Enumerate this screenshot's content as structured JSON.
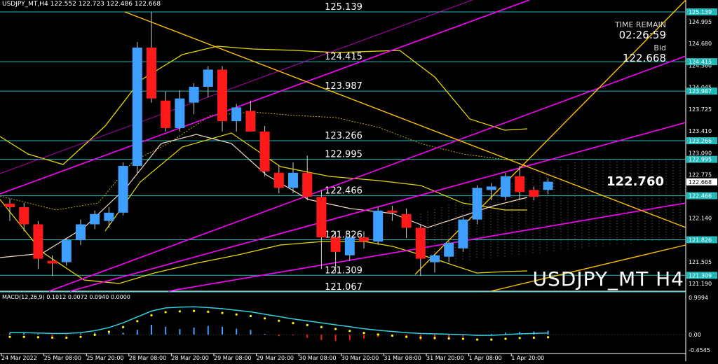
{
  "header": {
    "symbol_info": "USDJPY_MT,H4",
    "ohlc": "122.552 122.723 122.486 122.668"
  },
  "overlay": {
    "time_remain_label": "TIME REMAIN",
    "countdown": "02:26:59",
    "bid_label": "Bid",
    "bid_value": "122.668",
    "current_price_big": "122.760",
    "watermark": "USDJPY_MT H4"
  },
  "horizontal_levels": [
    {
      "label": "125.139",
      "price": 125.139
    },
    {
      "label": "124.415",
      "price": 124.415
    },
    {
      "label": "123.987",
      "price": 123.987
    },
    {
      "label": "123.266",
      "price": 123.266
    },
    {
      "label": "122.995",
      "price": 122.995
    },
    {
      "label": "122.466",
      "price": 122.466
    },
    {
      "label": "121.826",
      "price": 121.826
    },
    {
      "label": "121.309",
      "price": 121.309
    },
    {
      "label": "121.067",
      "price": 121.067
    }
  ],
  "price_axis": {
    "ticks": [
      "124.995",
      "124.680",
      "124.360",
      "124.045",
      "123.725",
      "123.410",
      "123.090",
      "122.775",
      "122.455",
      "122.140",
      "121.825",
      "121.505",
      "121.190"
    ],
    "level_tags": [
      "125.139",
      "124.415",
      "123.987",
      "123.266",
      "122.995",
      "122.668",
      "122.466",
      "121.826",
      "121.309"
    ],
    "current_tag": "122.668"
  },
  "time_axis": {
    "labels": [
      "24 Mar 2022",
      "25 Mar 08:00",
      "25 Mar 20:00",
      "28 Mar 08:00",
      "28 Mar 20:00",
      "29 Mar 08:00",
      "29 Mar 20:00",
      "30 Mar 08:00",
      "30 Mar 20:00",
      "31 Mar 08:00",
      "31 Mar 20:00",
      "1 Apr 08:00",
      "1 Apr 20:00"
    ]
  },
  "macd": {
    "header": "MACD(12,26,9) 0.1012 0.0072 0.0940 0.0000",
    "ticks": [
      "0.9994",
      "0.00",
      "-0.4545"
    ]
  },
  "colors": {
    "background": "#000000",
    "bull_candle": "#3f9fff",
    "bear_candle": "#ff1a1a",
    "level_line": "#20b8b8",
    "channel": "#ff00ff",
    "bands": "#e6d800",
    "trendline": "#ffc000",
    "macd_line": "#30d0e0",
    "macd_signal": "#ffff00"
  },
  "chart_data": {
    "type": "candlestick",
    "title": "USDJPY_MT H4",
    "categories": [
      "24 Mar 2022",
      "25 Mar 08:00",
      "25 Mar 20:00",
      "28 Mar 08:00",
      "28 Mar 20:00",
      "29 Mar 08:00",
      "29 Mar 20:00",
      "30 Mar 08:00",
      "30 Mar 20:00",
      "31 Mar 08:00",
      "31 Mar 20:00",
      "1 Apr 08:00",
      "1 Apr 20:00"
    ],
    "ohlc": [
      {
        "o": 122.35,
        "h": 122.42,
        "l": 122.1,
        "c": 122.3
      },
      {
        "o": 122.3,
        "h": 122.36,
        "l": 121.95,
        "c": 122.05
      },
      {
        "o": 122.05,
        "h": 122.1,
        "l": 121.4,
        "c": 121.55
      },
      {
        "o": 121.52,
        "h": 121.6,
        "l": 121.3,
        "c": 121.48
      },
      {
        "o": 121.5,
        "h": 121.85,
        "l": 121.45,
        "c": 121.82
      },
      {
        "o": 121.82,
        "h": 122.12,
        "l": 121.75,
        "c": 122.05
      },
      {
        "o": 122.05,
        "h": 122.25,
        "l": 121.98,
        "c": 122.2
      },
      {
        "o": 122.1,
        "h": 122.3,
        "l": 122.0,
        "c": 122.22
      },
      {
        "o": 122.22,
        "h": 122.95,
        "l": 122.18,
        "c": 122.9
      },
      {
        "o": 122.9,
        "h": 124.7,
        "l": 122.8,
        "c": 124.62
      },
      {
        "o": 124.62,
        "h": 125.14,
        "l": 123.82,
        "c": 123.88
      },
      {
        "o": 123.85,
        "h": 123.98,
        "l": 123.4,
        "c": 123.45
      },
      {
        "o": 123.45,
        "h": 124.0,
        "l": 123.4,
        "c": 123.88
      },
      {
        "o": 123.82,
        "h": 124.1,
        "l": 123.65,
        "c": 124.05
      },
      {
        "o": 124.05,
        "h": 124.35,
        "l": 123.9,
        "c": 124.3
      },
      {
        "o": 124.3,
        "h": 124.35,
        "l": 123.4,
        "c": 123.55
      },
      {
        "o": 123.55,
        "h": 123.8,
        "l": 123.4,
        "c": 123.75
      },
      {
        "o": 123.7,
        "h": 123.85,
        "l": 123.45,
        "c": 123.4
      },
      {
        "o": 123.4,
        "h": 123.48,
        "l": 122.75,
        "c": 122.82
      },
      {
        "o": 122.8,
        "h": 122.9,
        "l": 122.5,
        "c": 122.58
      },
      {
        "o": 122.58,
        "h": 122.95,
        "l": 122.5,
        "c": 122.8
      },
      {
        "o": 122.8,
        "h": 123.05,
        "l": 122.4,
        "c": 122.45
      },
      {
        "o": 122.45,
        "h": 122.55,
        "l": 121.4,
        "c": 121.86
      },
      {
        "o": 121.86,
        "h": 121.95,
        "l": 121.35,
        "c": 121.65
      },
      {
        "o": 121.6,
        "h": 121.88,
        "l": 121.52,
        "c": 121.86
      },
      {
        "o": 121.86,
        "h": 121.95,
        "l": 121.7,
        "c": 121.8
      },
      {
        "o": 121.8,
        "h": 122.3,
        "l": 121.75,
        "c": 122.25
      },
      {
        "o": 122.25,
        "h": 122.32,
        "l": 122.1,
        "c": 122.22
      },
      {
        "o": 122.2,
        "h": 122.28,
        "l": 121.85,
        "c": 122.0
      },
      {
        "o": 122.0,
        "h": 122.05,
        "l": 121.3,
        "c": 121.55
      },
      {
        "o": 121.5,
        "h": 121.62,
        "l": 121.35,
        "c": 121.6
      },
      {
        "o": 121.58,
        "h": 121.8,
        "l": 121.5,
        "c": 121.78
      },
      {
        "o": 121.7,
        "h": 122.15,
        "l": 121.65,
        "c": 122.12
      },
      {
        "o": 122.12,
        "h": 122.62,
        "l": 122.05,
        "c": 122.58
      },
      {
        "o": 122.55,
        "h": 122.65,
        "l": 122.4,
        "c": 122.6
      },
      {
        "o": 122.45,
        "h": 122.8,
        "l": 122.4,
        "c": 122.75
      },
      {
        "o": 122.75,
        "h": 122.9,
        "l": 122.4,
        "c": 122.52
      },
      {
        "o": 122.55,
        "h": 122.6,
        "l": 122.4,
        "c": 122.45
      },
      {
        "o": 122.55,
        "h": 122.72,
        "l": 122.49,
        "c": 122.67
      }
    ],
    "macd_histogram": [
      0.05,
      0.04,
      0.02,
      -0.05,
      -0.02,
      0.03,
      0.05,
      0.06,
      0.05,
      0.12,
      0.25,
      0.2,
      0.14,
      0.18,
      0.22,
      0.2,
      0.15,
      0.12,
      0.02,
      -0.04,
      -0.02,
      -0.08,
      -0.14,
      -0.16,
      -0.14,
      -0.1,
      -0.06,
      -0.05,
      -0.08,
      -0.14,
      -0.12,
      -0.1,
      -0.06,
      -0.02,
      0.02,
      0.05,
      0.07,
      0.08,
      0.1
    ],
    "macd_signal": [
      0.05,
      0.05,
      0.04,
      0.03,
      0.03,
      0.05,
      0.1,
      0.18,
      0.3,
      0.45,
      0.6,
      0.68,
      0.7,
      0.71,
      0.69,
      0.66,
      0.62,
      0.58,
      0.52,
      0.46,
      0.4,
      0.35,
      0.3,
      0.25,
      0.2,
      0.15,
      0.11,
      0.08,
      0.05,
      0.03,
      0.02,
      0.01,
      0.0,
      -0.02,
      -0.02,
      0.0,
      0.02,
      0.03,
      0.04
    ],
    "ylim": [
      121.19,
      125.14
    ]
  }
}
